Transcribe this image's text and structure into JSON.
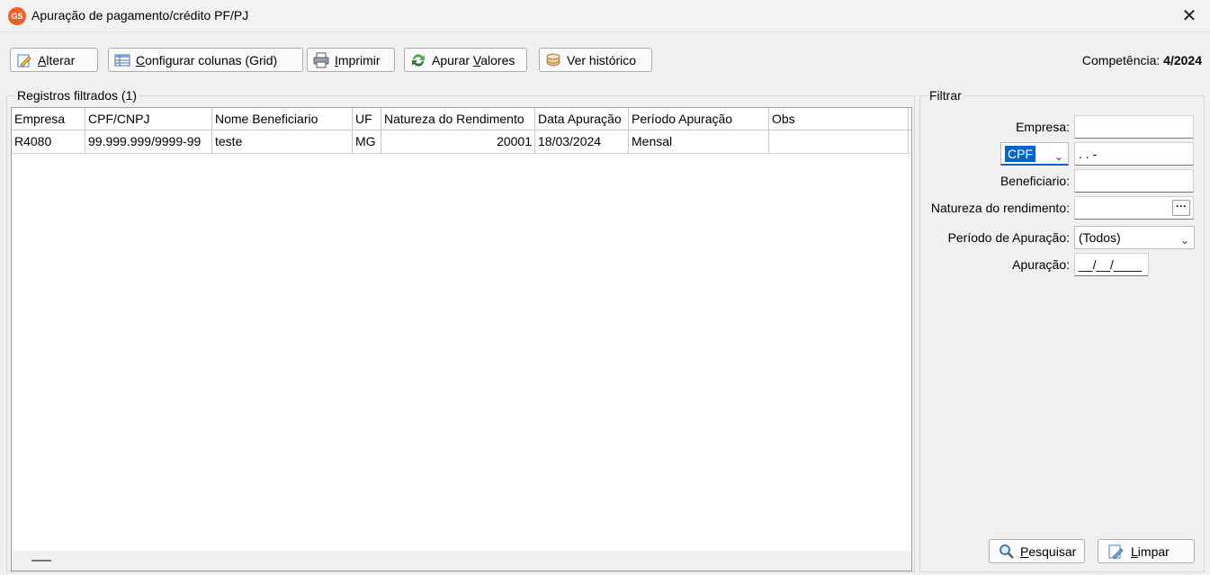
{
  "window": {
    "title": "Apuração de pagamento/crédito PF/PJ",
    "app_icon_text": "GS",
    "close_glyph": "✕"
  },
  "toolbar": {
    "alterar": {
      "pre": "",
      "u": "A",
      "post": "lterar"
    },
    "configurar": {
      "pre": "",
      "u": "C",
      "post": "onfigurar colunas (Grid)"
    },
    "imprimir": {
      "pre": "",
      "u": "I",
      "post": "mprimir"
    },
    "apurar": {
      "pre": "Apurar ",
      "u": "V",
      "post": "alores"
    },
    "historico": {
      "label": "Ver histórico"
    }
  },
  "competencia": {
    "label": "Competência:",
    "value": "4/2024"
  },
  "registros": {
    "label": "Registros filtrados (1)",
    "columns": [
      "Empresa",
      "CPF/CNPJ",
      "Nome Beneficiario",
      "UF",
      "Natureza do Rendimento",
      "Data Apuração",
      "Período Apuração",
      "Obs"
    ],
    "rows": [
      [
        "R4080",
        "99.999.999/9999-99",
        "teste",
        "MG",
        "20001",
        "18/03/2024",
        "Mensal",
        ""
      ]
    ]
  },
  "filtrar": {
    "label": "Filtrar",
    "empresa_label": "Empresa:",
    "empresa_value": "",
    "doc_type": "CPF",
    "doc_mask": " .  .  -",
    "beneficiario_label": "Beneficiario:",
    "beneficiario_value": "",
    "natureza_label": "Natureza do rendimento:",
    "natureza_value": "",
    "natureza_button": "···",
    "periodo_label": "Período de Apuração:",
    "periodo_value": "(Todos)",
    "apuracao_label": "Apuração:",
    "apuracao_mask": "__/__/____"
  },
  "actions": {
    "pesquisar": {
      "pre": "",
      "u": "P",
      "post": "esquisar"
    },
    "limpar": {
      "pre": "",
      "u": "L",
      "post": "impar"
    }
  },
  "colors": {
    "accent_selection": "#0a64c8",
    "app_icon": "#e8622a"
  }
}
